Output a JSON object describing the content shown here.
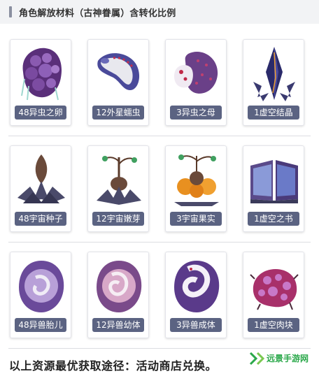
{
  "header": {
    "title": "角色解放材料（古神眷属）含转化比例"
  },
  "sections": [
    {
      "items": [
        {
          "label": "48异虫之卵",
          "icon": "egg-cluster-icon"
        },
        {
          "label": "12外星蠕虫",
          "icon": "worm-icon"
        },
        {
          "label": "3异虫之母",
          "icon": "broodmother-icon"
        },
        {
          "label": "1虚空结晶",
          "icon": "void-crystal-icon"
        }
      ]
    },
    {
      "items": [
        {
          "label": "48宇宙种子",
          "icon": "cosmic-seed-icon"
        },
        {
          "label": "12宇宙嫩芽",
          "icon": "cosmic-sprout-icon"
        },
        {
          "label": "3宇宙果实",
          "icon": "cosmic-fruit-icon"
        },
        {
          "label": "1虚空之书",
          "icon": "void-book-icon"
        }
      ]
    },
    {
      "items": [
        {
          "label": "48异兽胎儿",
          "icon": "beast-embryo-icon"
        },
        {
          "label": "12异兽幼体",
          "icon": "beast-larva-icon"
        },
        {
          "label": "3异兽成体",
          "icon": "beast-adult-icon"
        },
        {
          "label": "1虚空肉块",
          "icon": "void-flesh-icon"
        }
      ]
    }
  ],
  "footer": {
    "text": "以上资源最优获取途径：活动商店兑换。"
  },
  "brand": {
    "name": "远景手游网"
  },
  "colors": {
    "label_bg": "#5b6382",
    "accent_green": "#2aa84a",
    "header_bg": "#f2f3f5"
  }
}
